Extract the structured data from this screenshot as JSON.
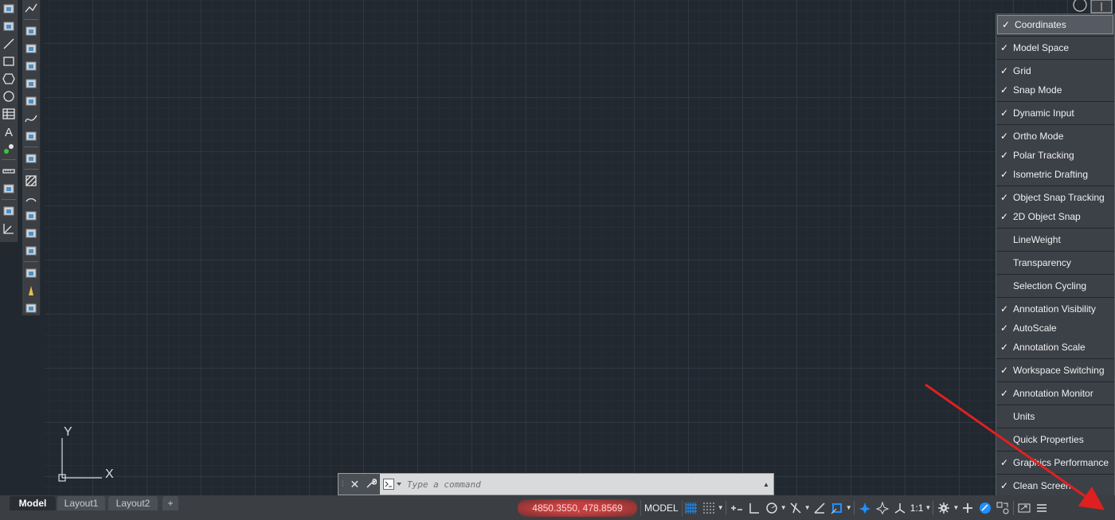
{
  "toolbar_left": {
    "column1_icons": [
      "new-layer-icon",
      "insert-block-icon",
      "line-icon",
      "rectangle-icon",
      "polygon-icon",
      "circle-icon",
      "table-icon",
      "text-icon",
      "point-icon",
      "measure-icon",
      "layer-properties-icon",
      "layer-states-icon",
      "coordinate-axes-icon"
    ],
    "column2_icons": [
      "polyline-icon",
      "block-icon",
      "block-edit-icon",
      "break-icon",
      "chamfer-icon",
      "fillet-icon",
      "spline-icon",
      "solid-icon",
      "copy-icon",
      "hatch-icon",
      "arc-icon",
      "revcloud-icon",
      "array-icon",
      "match-properties-icon",
      "group-icon",
      "pencil-icon",
      "pin-icon"
    ]
  },
  "ucs": {
    "x_label": "X",
    "y_label": "Y"
  },
  "customize_menu": {
    "items": [
      {
        "label": "Coordinates",
        "checked": true,
        "highlighted": true
      },
      {
        "label": "Model Space",
        "checked": true
      },
      {
        "label": "Grid",
        "checked": true
      },
      {
        "label": "Snap Mode",
        "checked": true
      },
      {
        "label": "Dynamic Input",
        "checked": true
      },
      {
        "label": "Ortho Mode",
        "checked": true
      },
      {
        "label": "Polar Tracking",
        "checked": true
      },
      {
        "label": "Isometric Drafting",
        "checked": true
      },
      {
        "label": "Object Snap Tracking",
        "checked": true
      },
      {
        "label": "2D Object Snap",
        "checked": true
      },
      {
        "label": "LineWeight",
        "checked": false
      },
      {
        "label": "Transparency",
        "checked": false
      },
      {
        "label": "Selection Cycling",
        "checked": false
      },
      {
        "label": "Annotation Visibility",
        "checked": true
      },
      {
        "label": "AutoScale",
        "checked": true
      },
      {
        "label": "Annotation Scale",
        "checked": true
      },
      {
        "label": "Workspace Switching",
        "checked": true
      },
      {
        "label": "Annotation Monitor",
        "checked": true
      },
      {
        "label": "Units",
        "checked": false
      },
      {
        "label": "Quick Properties",
        "checked": false
      },
      {
        "label": "Graphics Performance",
        "checked": true
      },
      {
        "label": "Clean Screen",
        "checked": true
      }
    ],
    "separators_after": [
      0,
      1,
      3,
      4,
      7,
      9,
      10,
      11,
      12,
      15,
      16,
      17,
      18,
      19,
      20
    ]
  },
  "layout_tabs": {
    "tabs": [
      "Model",
      "Layout1",
      "Layout2"
    ],
    "active": "Model",
    "add_tab_glyph": "+"
  },
  "command_line": {
    "close_glyph": "✕",
    "customize_icon": "wrench-icon",
    "prompt_icon": "command-prompt-icon",
    "placeholder": "Type a command",
    "history_glyph": "▲"
  },
  "status_bar": {
    "coordinates": "4850.3550, 478.8569",
    "model_label": "MODEL",
    "annotation_scale": "1:1",
    "icons": [
      "grid-icon",
      "snap-icon",
      "dynamic-input-icon",
      "ortho-icon",
      "polar-icon",
      "isodraft-icon",
      "object-snap-tracking-icon",
      "osnap-icon",
      "annotation-visibility-icon",
      "autoscale-icon",
      "annotation-scale-icon",
      "workspace-icon",
      "plus-icon",
      "annotation-monitor-icon",
      "graphics-performance-icon",
      "clean-screen-icon",
      "customization-menu-icon"
    ]
  },
  "colors": {
    "canvas_bg": "#212830",
    "toolbar_bg": "#3b3f44",
    "menu_bg": "#3c4047",
    "coord_highlight": "#c44040",
    "arrow": "#e02020",
    "blue_active": "#1e90ff"
  }
}
